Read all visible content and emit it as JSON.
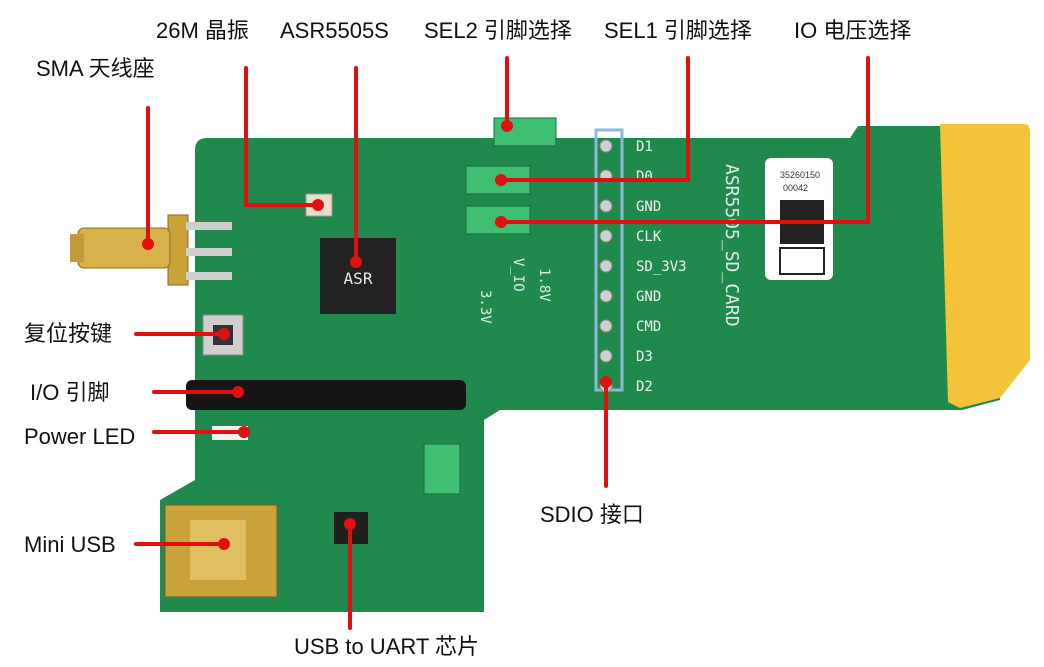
{
  "callouts": {
    "sma": "SMA 天线座",
    "crystal": "26M 晶振",
    "chip": "ASR5505S",
    "sel2": "SEL2 引脚选择",
    "sel1": "SEL1 引脚选择",
    "io_voltage": "IO 电压选择",
    "reset": "复位按键",
    "io_pins": "I/O 引脚",
    "power_led": "Power LED",
    "mini_usb": "Mini USB",
    "usb_uart": "USB to UART 芯片",
    "sdio": "SDIO  接口"
  },
  "board": {
    "name": "ASR5505_SD_CARD",
    "qr_number": "35260150",
    "qr_serial": "00042",
    "chip_marking": "ASR",
    "voltage_labels": [
      "3.3V",
      "V_IO",
      "1.8V"
    ],
    "sdio_pins": [
      "D1",
      "D0",
      "GND",
      "CLK",
      "SD_3V3",
      "GND",
      "CMD",
      "D3",
      "D2"
    ]
  },
  "colors": {
    "pcb": "#1f8a4c",
    "gold": "#f3c43a",
    "leader": "#e01010",
    "sdio_box": "#8fb8d8"
  }
}
